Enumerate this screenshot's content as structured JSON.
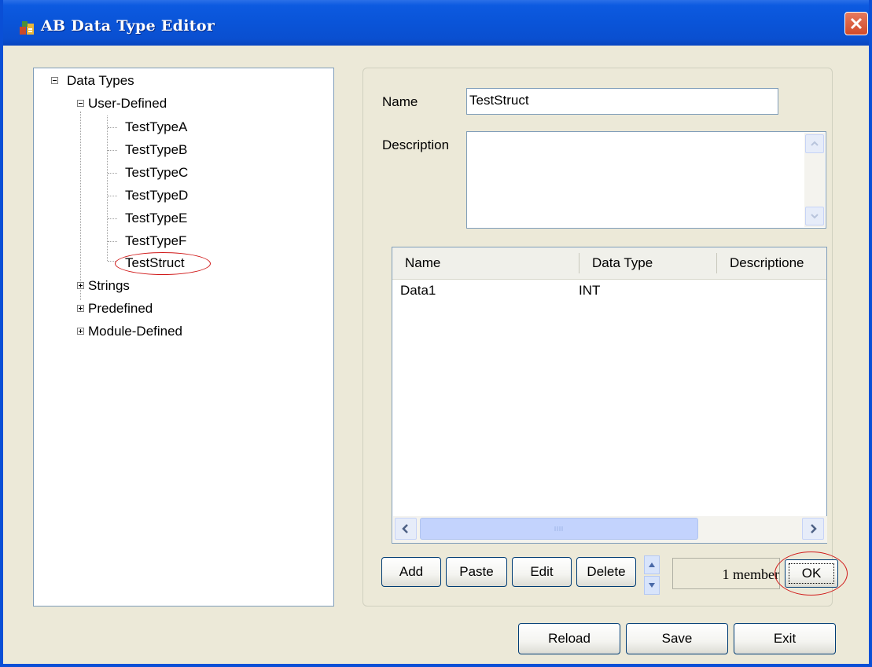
{
  "window": {
    "title": "AB Data Type Editor"
  },
  "tree": {
    "root": "Data Types",
    "user_defined": {
      "label": "User-Defined",
      "items": [
        "TestTypeA",
        "TestTypeB",
        "TestTypeC",
        "TestTypeD",
        "TestTypeE",
        "TestTypeF",
        "TestStruct"
      ],
      "selected": "TestStruct"
    },
    "others": [
      "Strings",
      "Predefined",
      "Module-Defined"
    ]
  },
  "form": {
    "name_label": "Name",
    "name_value": "TestStruct",
    "description_label": "Description",
    "description_value": ""
  },
  "members_table": {
    "columns": [
      "Name",
      "Data Type",
      "Descriptione"
    ],
    "rows": [
      {
        "name": "Data1",
        "data_type": "INT",
        "description": ""
      }
    ]
  },
  "member_buttons": {
    "add": "Add",
    "paste": "Paste",
    "edit": "Edit",
    "delete": "Delete"
  },
  "member_count": "1 member",
  "ok_button": "OK",
  "footer_buttons": {
    "reload": "Reload",
    "save": "Save",
    "exit": "Exit"
  },
  "colors": {
    "title_bar": "#0a54d8",
    "window_bg": "#ece9d8",
    "annotation_red": "#d01818"
  }
}
